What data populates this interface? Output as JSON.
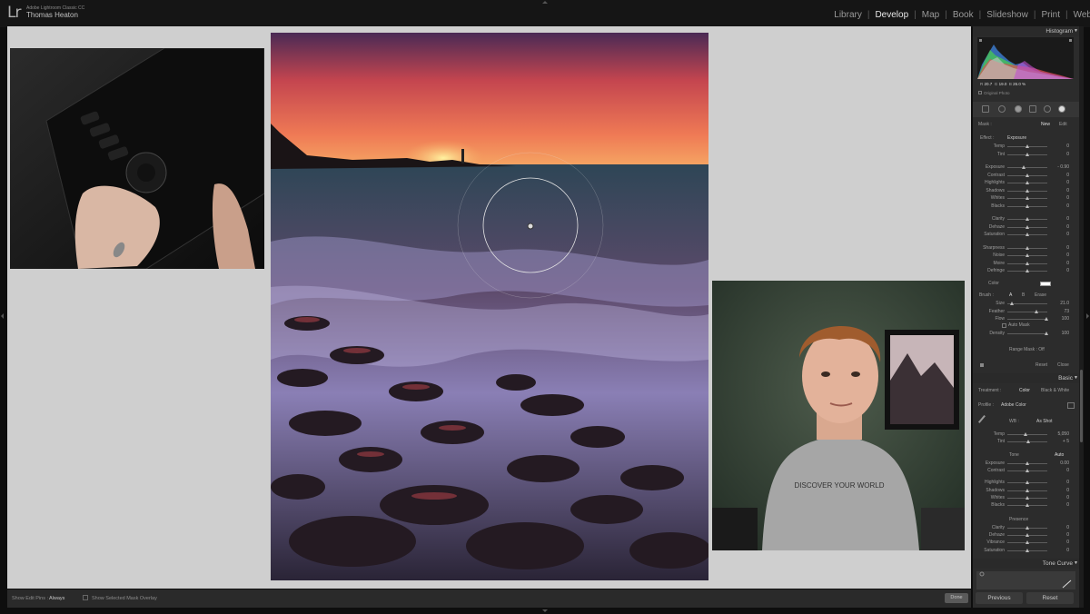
{
  "app": {
    "logo": "Lr",
    "product": "Adobe Lightroom Classic CC",
    "user": "Thomas Heaton"
  },
  "modules": [
    {
      "label": "Library",
      "active": false
    },
    {
      "label": "Develop",
      "active": true
    },
    {
      "label": "Map",
      "active": false
    },
    {
      "label": "Book",
      "active": false
    },
    {
      "label": "Slideshow",
      "active": false
    },
    {
      "label": "Print",
      "active": false
    },
    {
      "label": "Web",
      "active": false
    }
  ],
  "toolbar": {
    "show_edit_pins_label": "Show Edit Pins :",
    "show_edit_pins_value": "Always",
    "mask_overlay_label": "Show Selected Mask Overlay",
    "done": "Done"
  },
  "panel": {
    "histogram": {
      "title": "Histogram",
      "r_label": "R",
      "r": "20.7",
      "g_label": "G",
      "g": "19.0",
      "b_label": "B",
      "b": "26.0 %",
      "original": "Original Photo"
    },
    "mask": {
      "label": "Mask :",
      "new": "New",
      "edit": "Edit"
    },
    "effect": {
      "label": "Effect :",
      "value": "Exposure"
    },
    "sliders": [
      {
        "label": "Temp",
        "value": "0",
        "pos": 0.5
      },
      {
        "label": "Tint",
        "value": "0",
        "pos": 0.5
      },
      {
        "label": "Exposure",
        "value": "- 0.90",
        "pos": 0.4
      },
      {
        "label": "Contrast",
        "value": "0",
        "pos": 0.5
      },
      {
        "label": "Highlights",
        "value": "0",
        "pos": 0.5
      },
      {
        "label": "Shadows",
        "value": "0",
        "pos": 0.5
      },
      {
        "label": "Whites",
        "value": "0",
        "pos": 0.5
      },
      {
        "label": "Blacks",
        "value": "0",
        "pos": 0.5
      },
      {
        "label": "Clarity",
        "value": "0",
        "pos": 0.5
      },
      {
        "label": "Dehaze",
        "value": "0",
        "pos": 0.5
      },
      {
        "label": "Saturation",
        "value": "0",
        "pos": 0.5
      },
      {
        "label": "Sharpness",
        "value": "0",
        "pos": 0.5
      },
      {
        "label": "Noise",
        "value": "0",
        "pos": 0.5
      },
      {
        "label": "Moire",
        "value": "0",
        "pos": 0.5
      },
      {
        "label": "Defringe",
        "value": "0",
        "pos": 0.5
      }
    ],
    "color_label": "Color",
    "brush": {
      "label": "Brush :",
      "a": "A",
      "b": "B",
      "erase": "Erase"
    },
    "brush_sliders": [
      {
        "label": "Size",
        "value": "21.0",
        "pos": 0.12
      },
      {
        "label": "Feather",
        "value": "73",
        "pos": 0.73
      },
      {
        "label": "Flow",
        "value": "100",
        "pos": 0.98
      }
    ],
    "auto_mask": "Auto Mask",
    "density": {
      "label": "Density",
      "value": "100",
      "pos": 0.98
    },
    "range_mask": "Range Mask : Off",
    "reset": "Reset",
    "close": "Close",
    "basic": {
      "title": "Basic",
      "treatment": "Treatment :",
      "color": "Color",
      "bw": "Black & White",
      "profile": "Profile :",
      "profile_value": "Adobe Color",
      "wb": "WB :",
      "wb_value": "As Shot",
      "temp": {
        "label": "Temp",
        "value": "5,050",
        "pos": 0.45
      },
      "tint": {
        "label": "Tint",
        "value": "+ 5",
        "pos": 0.52
      },
      "tone": "Tone",
      "auto": "Auto",
      "tone_sliders": [
        {
          "label": "Exposure",
          "value": "0.00",
          "pos": 0.5
        },
        {
          "label": "Contrast",
          "value": "0",
          "pos": 0.5
        },
        {
          "label": "Highlights",
          "value": "0",
          "pos": 0.5
        },
        {
          "label": "Shadows",
          "value": "0",
          "pos": 0.5
        },
        {
          "label": "Whites",
          "value": "0",
          "pos": 0.5
        },
        {
          "label": "Blacks",
          "value": "0",
          "pos": 0.5
        }
      ],
      "presence": "Presence",
      "presence_sliders": [
        {
          "label": "Clarity",
          "value": "0",
          "pos": 0.5
        },
        {
          "label": "Dehaze",
          "value": "0",
          "pos": 0.5
        },
        {
          "label": "Vibrance",
          "value": "0",
          "pos": 0.5
        },
        {
          "label": "Saturation",
          "value": "0",
          "pos": 0.5
        }
      ]
    },
    "tone_curve": "Tone Curve",
    "previous": "Previous",
    "reset_btn": "Reset"
  },
  "video_overlay": {
    "shirt_text": "DISCOVER YOUR WORLD"
  }
}
